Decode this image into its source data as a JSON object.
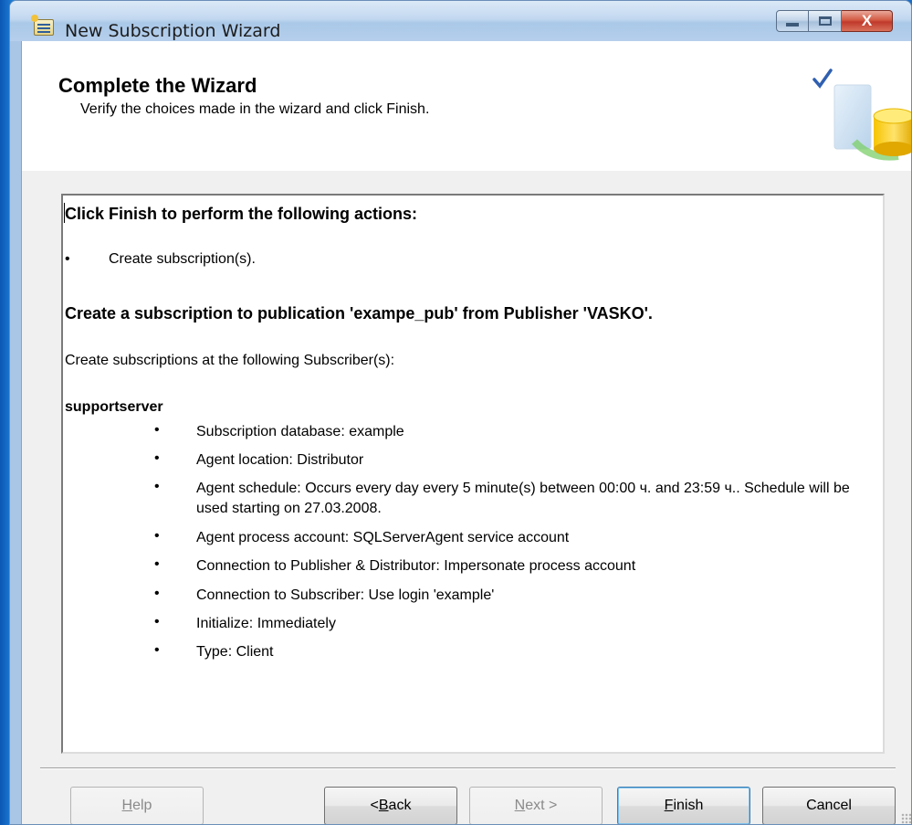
{
  "window": {
    "title": "New Subscription Wizard",
    "controls": {
      "minimize": "minimize",
      "maximize": "maximize",
      "close": "X"
    }
  },
  "header": {
    "title": "Complete the Wizard",
    "subtitle": "Verify the choices made in the wizard and click Finish."
  },
  "summary": {
    "heading": "Click Finish to perform the following actions:",
    "actions": [
      "Create subscription(s)."
    ],
    "publication_heading": "Create a subscription to publication 'exampe_pub' from Publisher 'VASKO'.",
    "subscribers_intro": "Create subscriptions at the following Subscriber(s):",
    "subscriber_name": "supportserver",
    "details": [
      "Subscription database: example",
      "Agent location: Distributor",
      "Agent schedule: Occurs every day every 5 minute(s) between 00:00 ч. and 23:59 ч.. Schedule will be used starting on 27.03.2008.",
      "Agent process account: SQLServerAgent service account",
      "Connection to Publisher & Distributor: Impersonate process account",
      "Connection to Subscriber: Use login 'example'",
      "Initialize: Immediately",
      "Type: Client"
    ],
    "bullet": "•"
  },
  "buttons": {
    "help": {
      "label": "Help",
      "mnemonic": "H",
      "rest": "elp",
      "enabled": false
    },
    "back": {
      "prefix": "< ",
      "mnemonic": "B",
      "rest": "ack",
      "enabled": true
    },
    "next": {
      "mnemonic": "N",
      "rest": "ext >",
      "enabled": false
    },
    "finish": {
      "mnemonic": "F",
      "rest": "inish",
      "enabled": true,
      "default": true
    },
    "cancel": {
      "label": "Cancel",
      "enabled": true
    }
  },
  "icons": {
    "app": "wizard-app-icon",
    "header": "database-checkmark-icon"
  },
  "colors": {
    "desktop": "#1a74c8",
    "titlebar": "#c2d8f0",
    "close_button": "#c0392b",
    "dialog_bg": "#f0f0f0"
  }
}
